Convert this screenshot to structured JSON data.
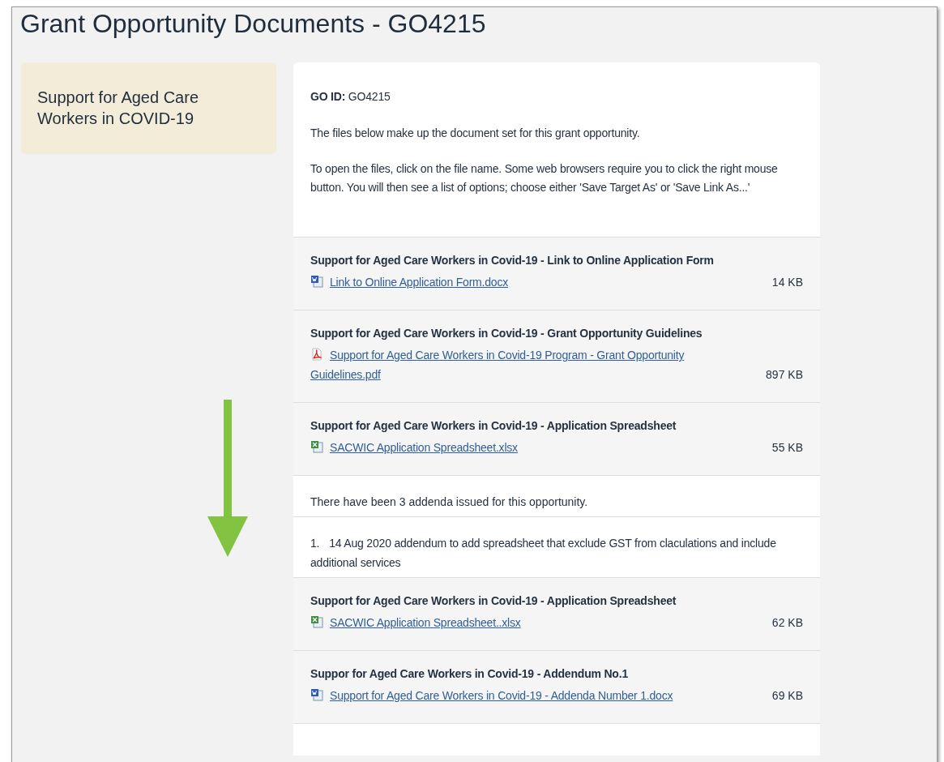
{
  "title": "Grant Opportunity Documents - GO4215",
  "sidebar": {
    "text": "Support for Aged Care Workers in COVID-19"
  },
  "intro": {
    "go_id_label": "GO ID:",
    "go_id": "GO4215",
    "paragraphs": [
      "The files below make up the document set for this grant opportunity.",
      "To open the files, click on the file name. Some web browsers require you to click the right mouse button. You will then see a list of options; choose either 'Save Target As' or 'Save Link As...'"
    ]
  },
  "items": [
    {
      "kind": "file",
      "heading": "Support for Aged Care Workers in Covid-19 - Link to Online Application Form",
      "icon": {
        "kind": "word"
      },
      "link": "Link to Online Application Form.docx",
      "size": "14 KB"
    },
    {
      "kind": "file",
      "heading": "Support for Aged Care Workers in Covid-19 - Grant Opportunity Guidelines",
      "icon": {
        "kind": "pdf"
      },
      "link": "Support for Aged Care Workers in Covid-19 Program - Grant Opportunity Guidelines.pdf",
      "size": "897 KB"
    },
    {
      "kind": "file",
      "heading": "Support for Aged Care Workers in Covid-19 - Application Spreadsheet",
      "icon": {
        "kind": "excel"
      },
      "link": "SACWIC Application Spreadsheet.xlsx",
      "size": "55 KB"
    },
    {
      "kind": "note",
      "text": "There have been 3 addenda issued for this opportunity."
    },
    {
      "kind": "addendum",
      "number": "1.",
      "text": "14 Aug 2020 addendum to add spreadsheet that exclude GST from claculations and include additional services"
    },
    {
      "kind": "file",
      "heading": "Support for Aged Care Workers in Covid-19 - Application Spreadsheet",
      "icon": {
        "kind": "excel"
      },
      "link": "SACWIC Application Spreadsheet..xlsx",
      "size": "62 KB"
    },
    {
      "kind": "file",
      "heading": "Suppor for Aged Care Workers in Covid-19 - Addendum No.1",
      "icon": {
        "kind": "word"
      },
      "link": "Support for Aged Care Workers in Covid-19 - Addenda Number 1.docx",
      "size": "69 KB"
    }
  ]
}
